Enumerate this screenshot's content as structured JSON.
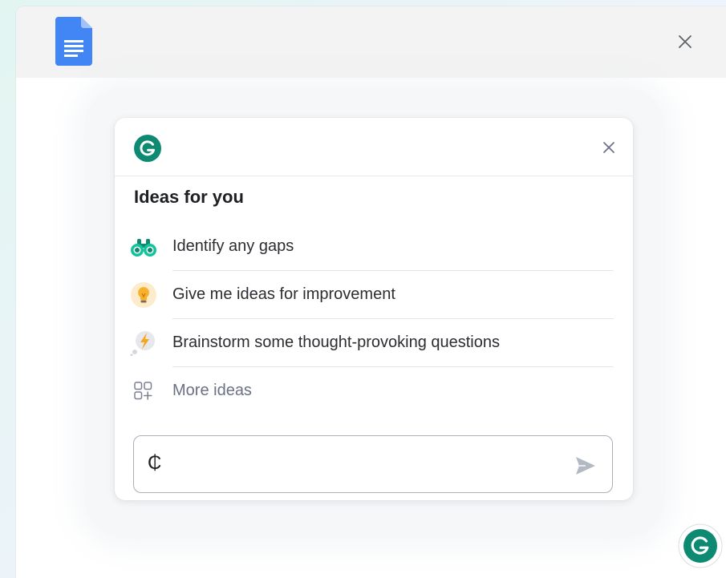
{
  "colors": {
    "brand": "#15c39a",
    "brand_dark": "#0e8a72",
    "docs_blue": "#4285f4",
    "send_gray": "#b3b9c3"
  },
  "window": {
    "app_icon": "google-docs-icon",
    "close_icon": "close-icon"
  },
  "panel": {
    "logo_icon": "grammarly-logo-icon",
    "close_icon": "close-icon",
    "title": "Ideas for you",
    "ideas": [
      {
        "icon": "binoculars-icon",
        "label": "Identify any gaps"
      },
      {
        "icon": "lightbulb-icon",
        "label": "Give me ideas for improvement"
      },
      {
        "icon": "thought-bolt-icon",
        "label": "Brainstorm some thought-provoking questions"
      },
      {
        "icon": "grid-sparkle-icon",
        "label": "More ideas"
      }
    ],
    "input": {
      "value": "₵",
      "send_icon": "send-icon"
    }
  },
  "fab": {
    "icon": "grammarly-button-icon"
  }
}
